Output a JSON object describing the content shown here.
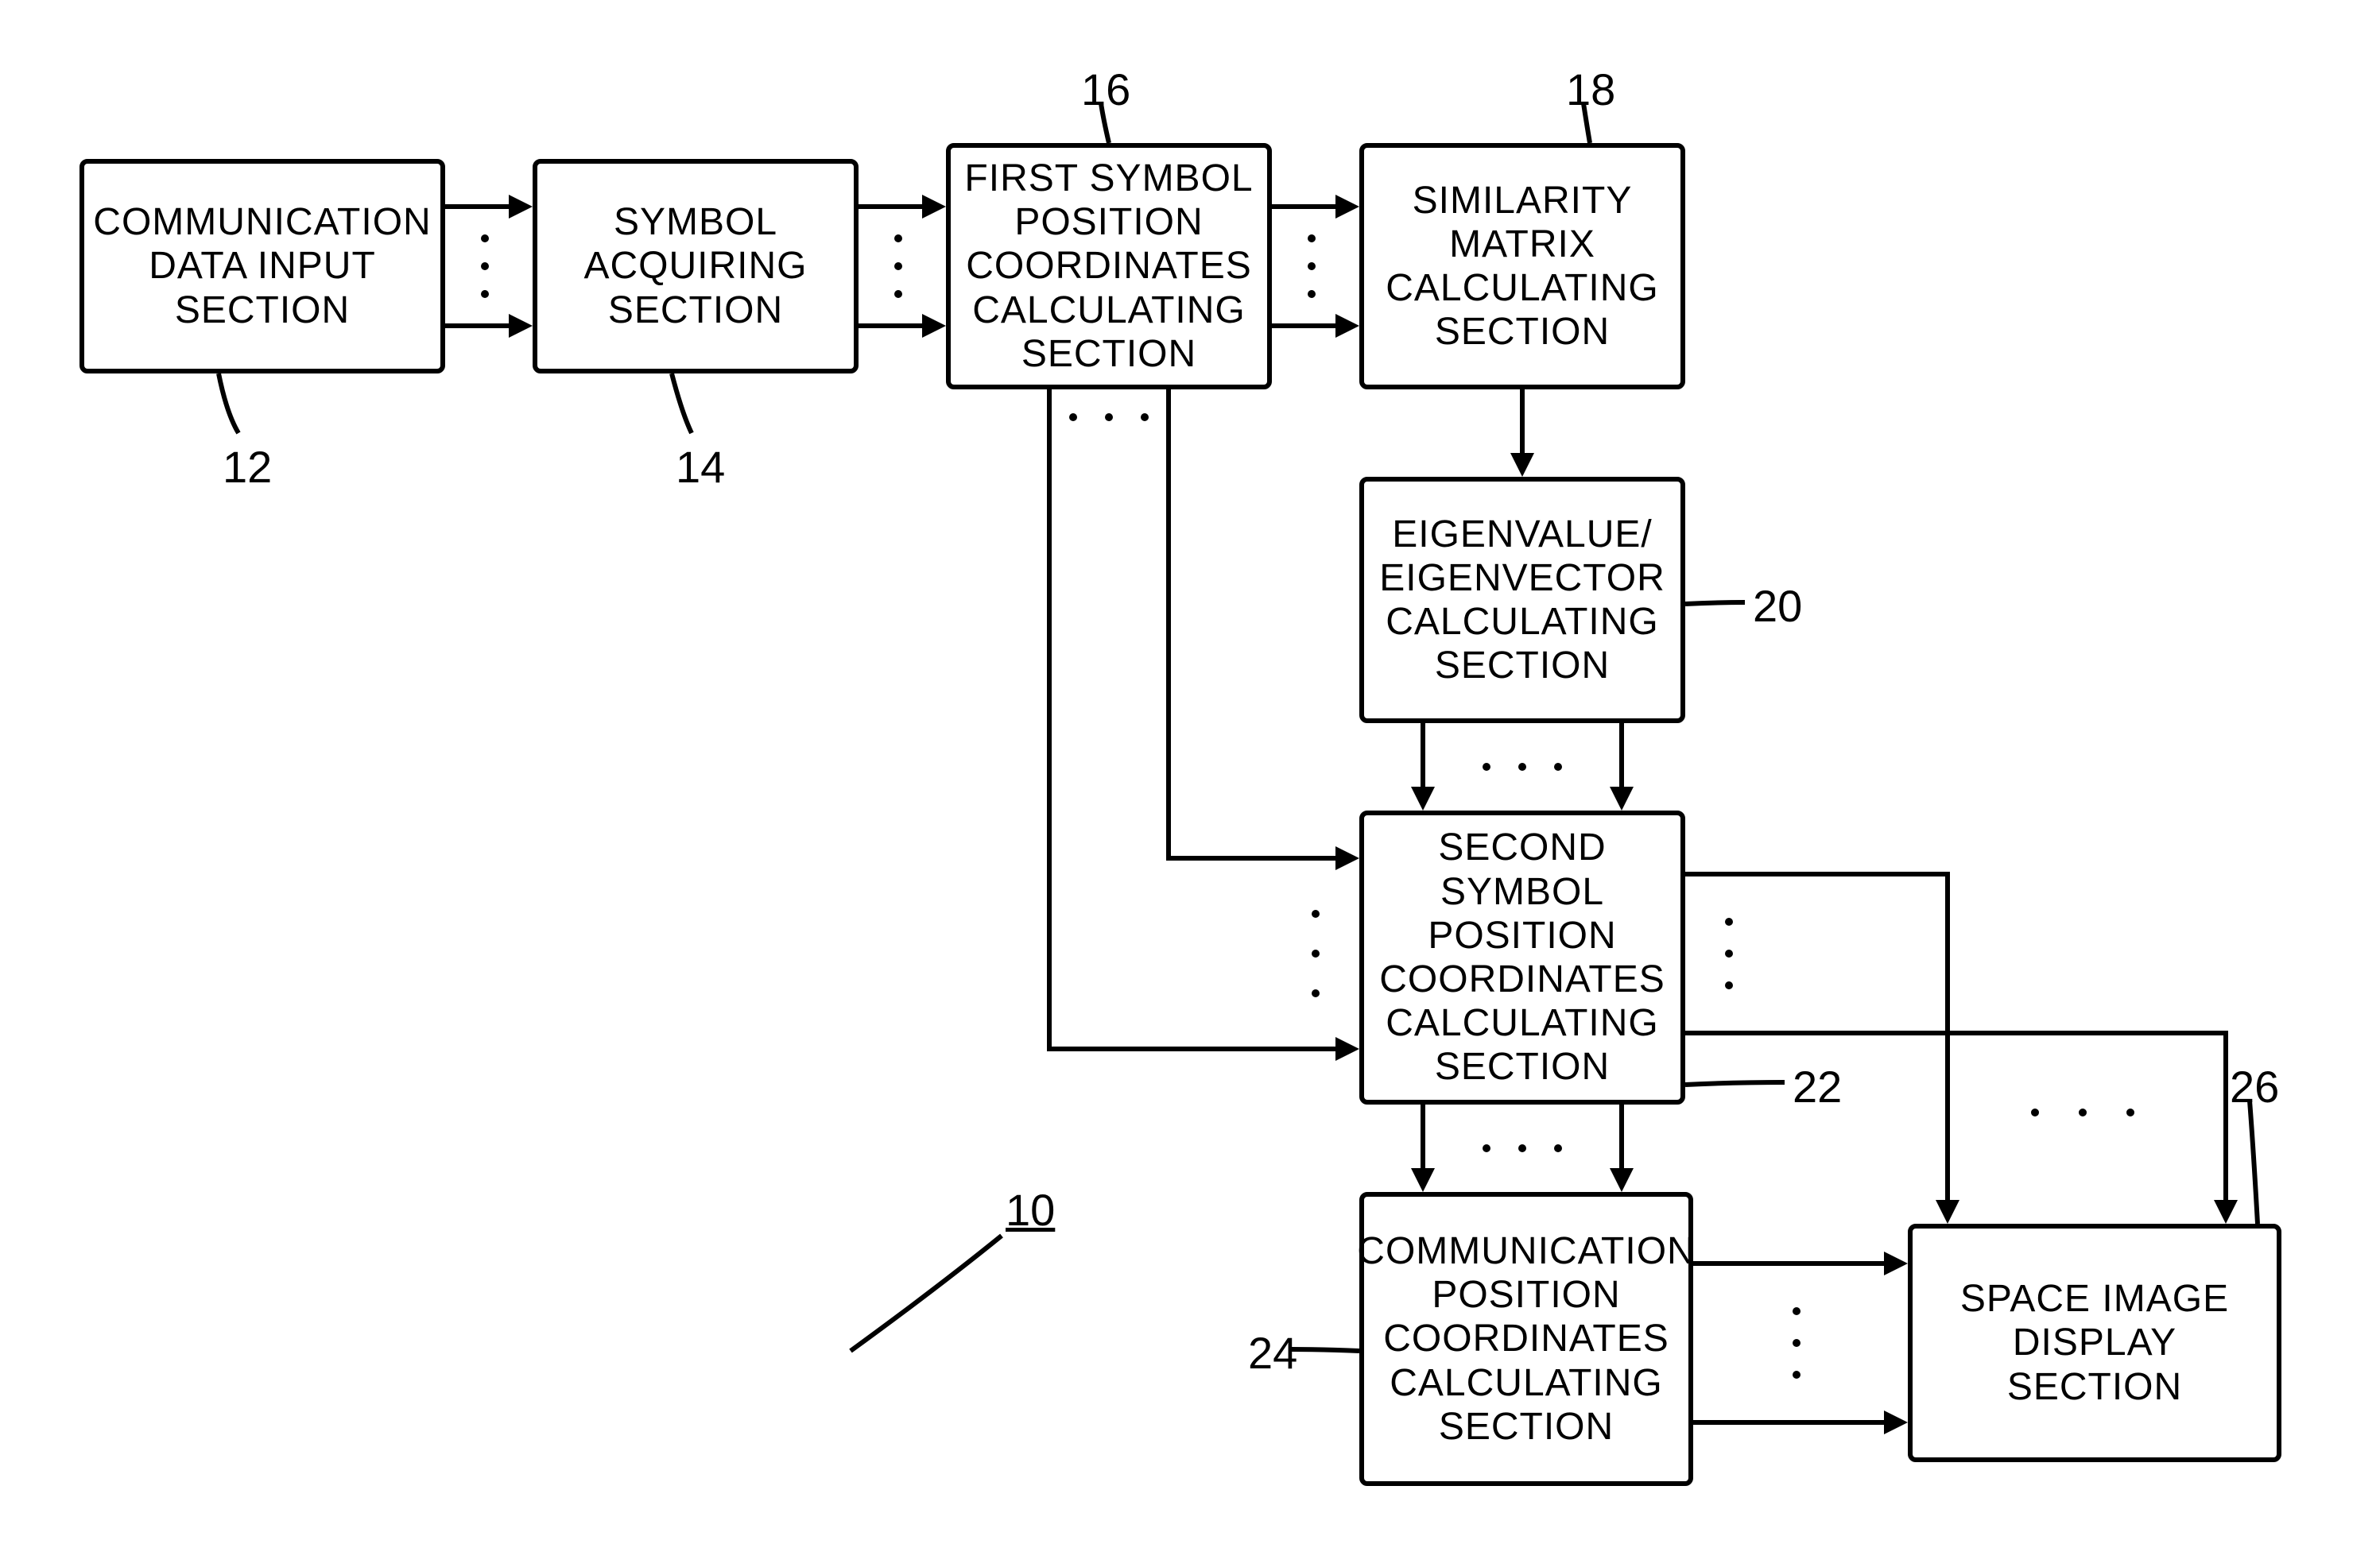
{
  "blocks": {
    "b12": {
      "text": "COMMUNICATION\nDATA INPUT\nSECTION"
    },
    "b14": {
      "text": "SYMBOL\nACQUIRING\nSECTION"
    },
    "b16": {
      "text": "FIRST SYMBOL\nPOSITION\nCOORDINATES\nCALCULATING\nSECTION"
    },
    "b18": {
      "text": "SIMILARITY\nMATRIX\nCALCULATING\nSECTION"
    },
    "b20": {
      "text": "EIGENVALUE/\nEIGENVECTOR\nCALCULATING\nSECTION"
    },
    "b22": {
      "text": "SECOND\nSYMBOL\nPOSITION\nCOORDINATES\nCALCULATING\nSECTION"
    },
    "b24": {
      "text": "COMMUNICATION\nPOSITION\nCOORDINATES\nCALCULATING\nSECTION"
    },
    "b26": {
      "text": "SPACE IMAGE\nDISPLAY SECTION"
    }
  },
  "labels": {
    "l12": "12",
    "l14": "14",
    "l16": "16",
    "l18": "18",
    "l20": "20",
    "l22": "22",
    "l24": "24",
    "l26": "26",
    "l10": "10"
  }
}
